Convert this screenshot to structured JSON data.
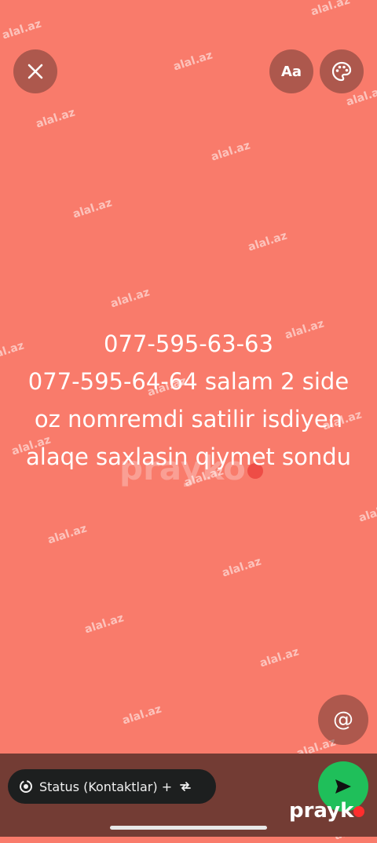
{
  "status": {
    "text_lines": [
      "077-595-63-63",
      "077-595-64-64 salam 2 side",
      "oz nomremdi satilir isdiyen",
      "alaqe saxlasin qiymet sondu"
    ],
    "background_color": "#f97b6b"
  },
  "toolbar": {
    "close_icon": "close-icon",
    "font_label": "Aa",
    "palette_icon": "palette-icon"
  },
  "mention": {
    "icon": "at-icon",
    "label": "@"
  },
  "audience": {
    "label": "Status (Kontaktlar) +",
    "icon": "status-ring-icon",
    "swap_icon": "repeat-icon"
  },
  "send": {
    "icon": "send-icon"
  },
  "watermarks": {
    "site": "alal.az",
    "center": "prayko",
    "brand": "prayk"
  }
}
